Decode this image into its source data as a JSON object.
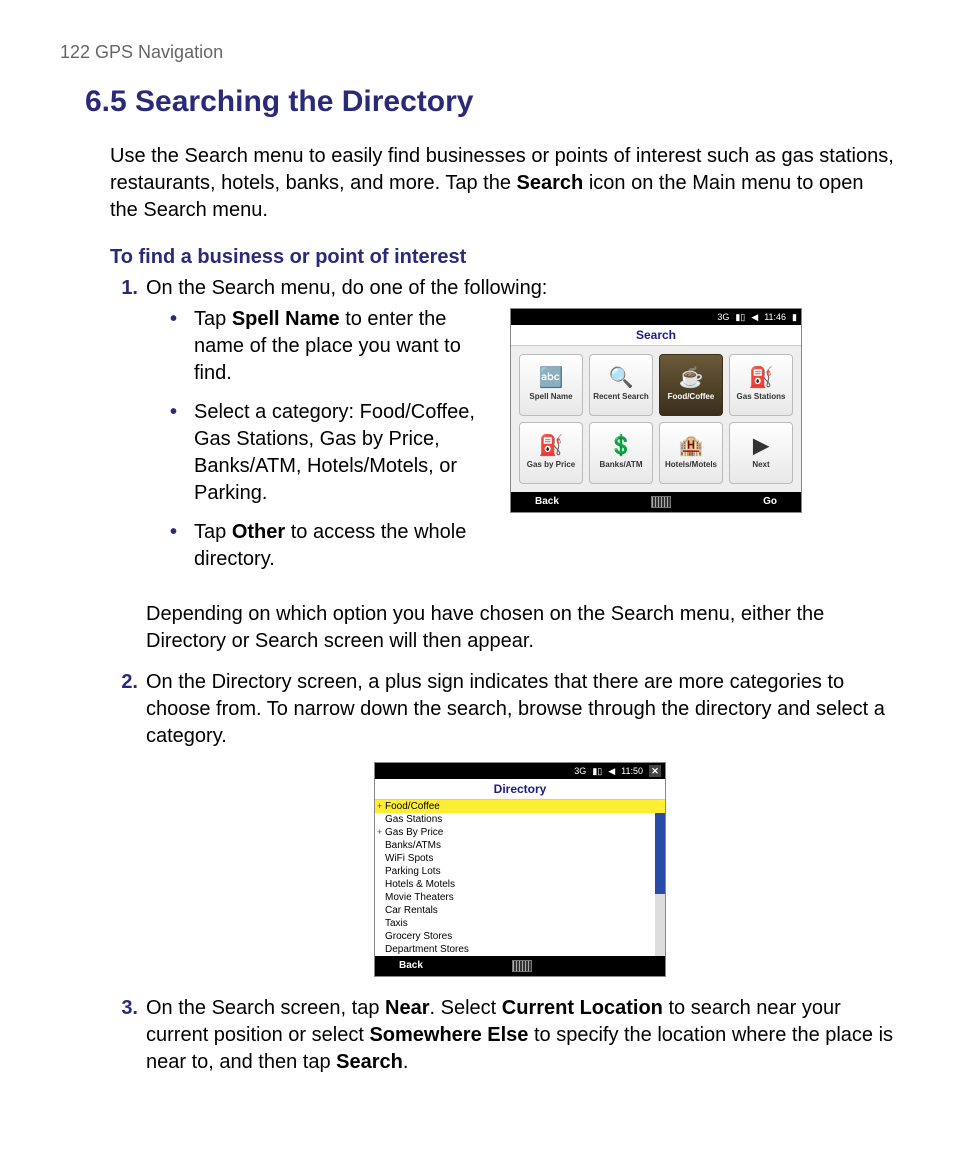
{
  "page_header": "122  GPS Navigation",
  "section_title": "6.5  Searching the Directory",
  "intro_a": "Use the Search menu to easily find businesses or points of interest such as gas stations, restaurants, hotels, banks, and more. Tap the ",
  "intro_bold": "Search",
  "intro_b": " icon on the Main menu to open the Search menu.",
  "subheading": "To find a business or point of interest",
  "step1_intro": "On the Search menu, do one of the following:",
  "bullet1_a": "Tap ",
  "bullet1_bold": "Spell Name",
  "bullet1_b": " to enter the name of the place you want to find.",
  "bullet2": "Select a category: Food/Coffee, Gas Stations, Gas by Price, Banks/ATM, Hotels/Motels, or Parking.",
  "bullet3_a": "Tap ",
  "bullet3_bold": "Other",
  "bullet3_b": " to access the whole directory.",
  "step1_after": "Depending on which option you have chosen on the Search menu, either the Directory or Search screen will then appear.",
  "step2": "On the Directory screen, a plus sign indicates that there are more categories to choose from. To narrow down the search, browse through the directory and select a category.",
  "step3_a": "On the Search screen, tap ",
  "step3_b1": "Near",
  "step3_c": ". Select ",
  "step3_b2": "Current Location",
  "step3_d": " to search near your current position or select ",
  "step3_b3": "Somewhere Else",
  "step3_e": " to specify the location where the place is near to, and then tap ",
  "step3_b4": "Search",
  "step3_f": ".",
  "nums": {
    "n1": "1.",
    "n2": "2.",
    "n3": "3."
  },
  "search_screen": {
    "status": {
      "net": "3G",
      "time": "11:46"
    },
    "title": "Search",
    "tiles": [
      {
        "label": "Spell Name",
        "glyph": "🔤",
        "selected": false
      },
      {
        "label": "Recent Search",
        "glyph": "🔍",
        "selected": false
      },
      {
        "label": "Food/Coffee",
        "glyph": "☕",
        "selected": true
      },
      {
        "label": "Gas Stations",
        "glyph": "⛽",
        "selected": false
      },
      {
        "label": "Gas by Price",
        "glyph": "⛽",
        "selected": false
      },
      {
        "label": "Banks/ATM",
        "glyph": "💲",
        "selected": false
      },
      {
        "label": "Hotels/Motels",
        "glyph": "🏨",
        "selected": false
      },
      {
        "label": "Next",
        "glyph": "▶",
        "selected": false
      }
    ],
    "bottom": {
      "left": "Back",
      "right": "Go"
    }
  },
  "directory_screen": {
    "status": {
      "net": "3G",
      "time": "11:50",
      "close": "✕"
    },
    "title": "Directory",
    "items": [
      {
        "label": "Food/Coffee",
        "plus": true,
        "selected": true
      },
      {
        "label": "Gas Stations",
        "plus": false,
        "selected": false
      },
      {
        "label": "Gas By Price",
        "plus": true,
        "selected": false
      },
      {
        "label": "Banks/ATMs",
        "plus": false,
        "selected": false
      },
      {
        "label": "WiFi Spots",
        "plus": false,
        "selected": false
      },
      {
        "label": "Parking Lots",
        "plus": false,
        "selected": false
      },
      {
        "label": "Hotels & Motels",
        "plus": false,
        "selected": false
      },
      {
        "label": "Movie Theaters",
        "plus": false,
        "selected": false
      },
      {
        "label": "Car Rentals",
        "plus": false,
        "selected": false
      },
      {
        "label": "Taxis",
        "plus": false,
        "selected": false
      },
      {
        "label": "Grocery Stores",
        "plus": false,
        "selected": false
      },
      {
        "label": "Department Stores",
        "plus": false,
        "selected": false
      }
    ],
    "bottom": {
      "left": "Back"
    }
  }
}
